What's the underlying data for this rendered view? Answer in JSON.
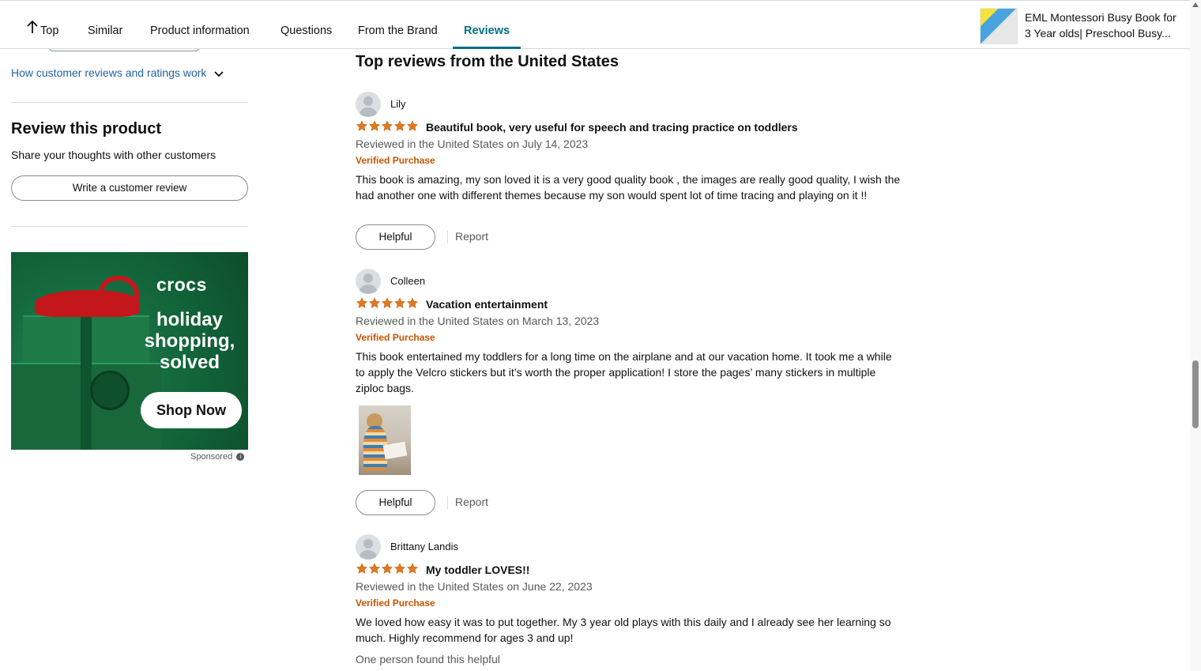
{
  "nav": {
    "top": "Top",
    "similar": "Similar",
    "product_information": "Product information",
    "questions": "Questions",
    "from_brand": "From the Brand",
    "reviews": "Reviews",
    "product_title": "EML Montessori Busy Book for 3 Year olds| Preschool Busy..."
  },
  "sidebar": {
    "how_link": "How customer reviews and ratings work",
    "review_heading": "Review this product",
    "review_sub": "Share your thoughts with other customers",
    "write_button": "Write a customer review"
  },
  "ad": {
    "brand": "crocs",
    "copy": "holiday shopping, solved",
    "cta": "Shop Now",
    "sponsored": "Sponsored",
    "accent": "#c4171b",
    "background": "#146a3d"
  },
  "reviews": {
    "heading": "Top reviews from the United States",
    "star_color": "#de7921",
    "items": [
      {
        "name": "Lily",
        "rating": 5,
        "title": "Beautiful book, very useful for speech and tracing practice on toddlers",
        "date": "Reviewed in the United States on July 14, 2023",
        "verified": "Verified Purchase",
        "body": "This book is amazing, my son loved it is a very good quality book , the images are really good quality, I wish the had another one with different themes because my son would spent lot of time tracing and playing on it !!",
        "helpful": "Helpful",
        "report": "Report"
      },
      {
        "name": "Colleen",
        "rating": 5,
        "title": "Vacation entertainment",
        "date": "Reviewed in the United States on March 13, 2023",
        "verified": "Verified Purchase",
        "body": "This book entertained my toddlers for a long time on the airplane and at our vacation home. It took me a while to apply the Velcro stickers but it’s worth the proper application! I store the pages’ many stickers in multiple ziploc bags.",
        "helpful": "Helpful",
        "report": "Report"
      },
      {
        "name": "Brittany Landis",
        "rating": 5,
        "title": "My toddler LOVES!!",
        "date": "Reviewed in the United States on June 22, 2023",
        "verified": "Verified Purchase",
        "body": "We loved how easy it was to put together. My 3 year old plays with this daily and I already see her learning so much. Highly recommend for ages 3 and up!",
        "found_helpful": "One person found this helpful"
      }
    ]
  }
}
